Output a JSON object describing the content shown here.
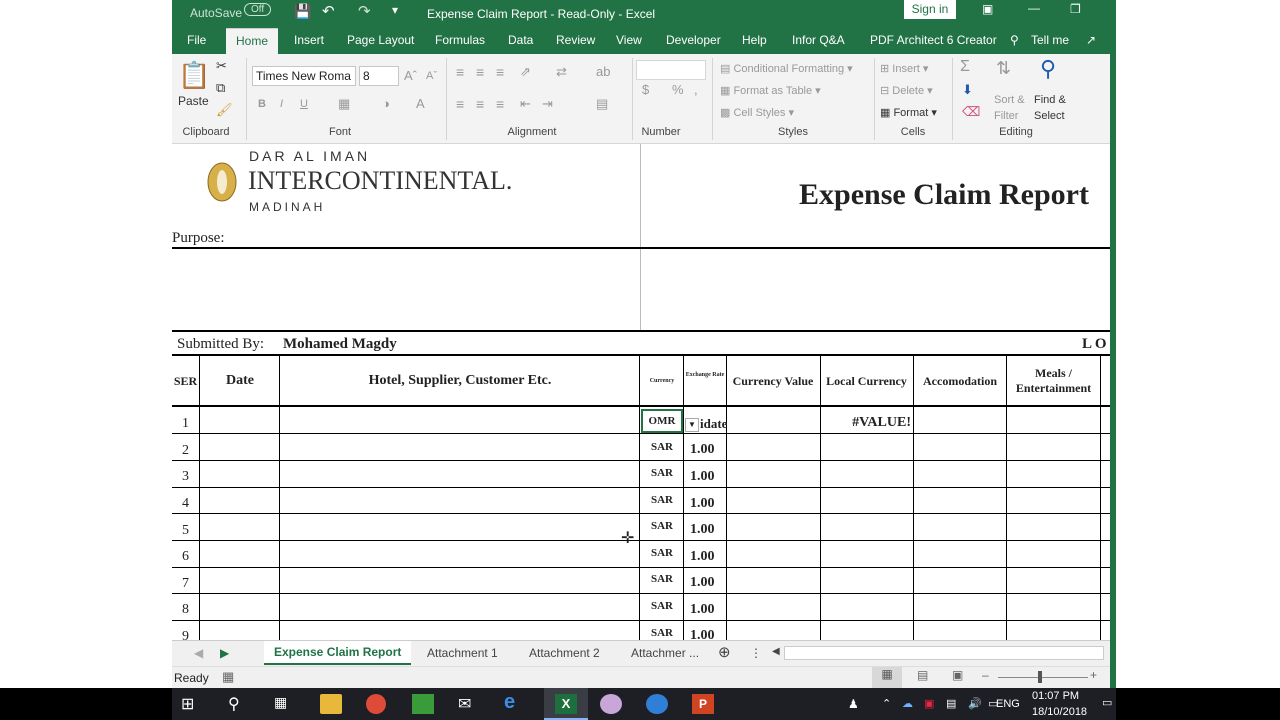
{
  "window": {
    "title": "Expense Claim Report  -  Read-Only  -  Excel",
    "autosave": "AutoSave",
    "autosave_state": "Off",
    "sign_in": "Sign in"
  },
  "tabs": [
    "File",
    "Home",
    "Insert",
    "Page Layout",
    "Formulas",
    "Data",
    "Review",
    "View",
    "Developer",
    "Help",
    "Infor Q&A",
    "PDF Architect 6 Creator"
  ],
  "tell_me": "Tell me",
  "ribbon": {
    "clipboard": {
      "label": "Clipboard",
      "paste": "Paste"
    },
    "font": {
      "label": "Font",
      "name": "Times New Roma",
      "size": "8"
    },
    "alignment": {
      "label": "Alignment"
    },
    "number": {
      "label": "Number",
      "currency": "$",
      "percent": "%"
    },
    "styles": {
      "label": "Styles",
      "conditional": "Conditional Formatting",
      "format_table": "Format as Table",
      "cell_styles": "Cell Styles"
    },
    "cells": {
      "label": "Cells",
      "insert": "Insert",
      "delete": "Delete",
      "format": "Format"
    },
    "editing": {
      "label": "Editing",
      "sort": "Sort &",
      "filter": "Filter",
      "find": "Find &",
      "select": "Select"
    }
  },
  "sheet": {
    "logo_top": "DAR AL IMAN",
    "logo_main": "INTERCONTINENTAL.",
    "logo_bottom": "MADINAH",
    "title": "Expense Claim Report",
    "purpose_label": "Purpose:",
    "submitted_label": "Submitted By:",
    "submitted_name": "Mohamed Magdy",
    "right_partial": "L O",
    "headers": [
      "SER",
      "Date",
      "Hotel, Supplier, Customer Etc.",
      "Currency",
      "Exchange Rate",
      "Currency Value",
      "Local Currency",
      "Accomodation",
      "Meals / Entertainment"
    ],
    "rows": [
      {
        "ser": "1",
        "currency": "OMR",
        "rate": "idate",
        "local": "#VALUE!"
      },
      {
        "ser": "2",
        "currency": "SAR",
        "rate": "1.00",
        "local": ""
      },
      {
        "ser": "3",
        "currency": "SAR",
        "rate": "1.00",
        "local": ""
      },
      {
        "ser": "4",
        "currency": "SAR",
        "rate": "1.00",
        "local": ""
      },
      {
        "ser": "5",
        "currency": "SAR",
        "rate": "1.00",
        "local": ""
      },
      {
        "ser": "6",
        "currency": "SAR",
        "rate": "1.00",
        "local": ""
      },
      {
        "ser": "7",
        "currency": "SAR",
        "rate": "1.00",
        "local": ""
      },
      {
        "ser": "8",
        "currency": "SAR",
        "rate": "1.00",
        "local": ""
      },
      {
        "ser": "9",
        "currency": "SAR",
        "rate": "1.00",
        "local": ""
      }
    ]
  },
  "sheet_tabs": [
    "Expense Claim Report",
    "Attachment 1",
    "Attachment 2",
    "Attachmer ..."
  ],
  "status": "Ready",
  "clock": {
    "time": "01:07 PM",
    "date": "18/10/2018"
  },
  "lang": "ENG"
}
